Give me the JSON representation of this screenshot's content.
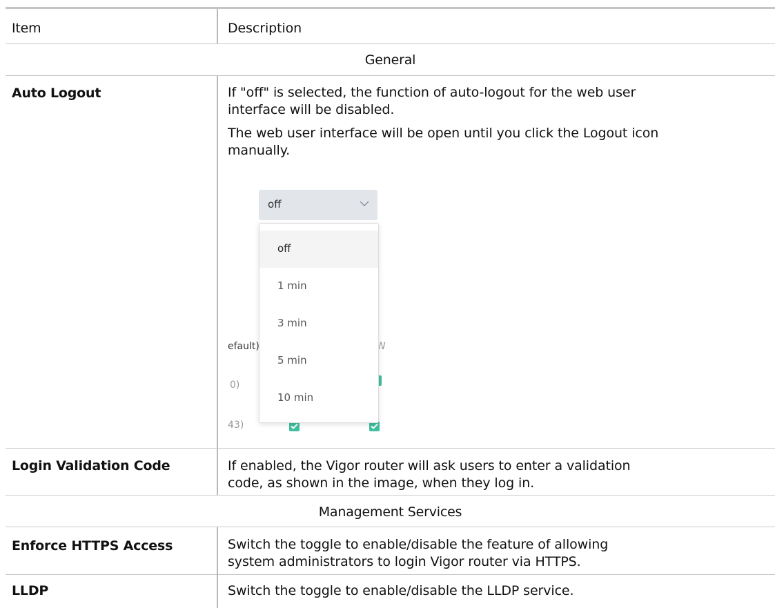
{
  "table": {
    "header": {
      "item": "Item",
      "description": "Description"
    },
    "sections": [
      {
        "title": "General",
        "rows": [
          {
            "item": "Auto Logout",
            "desc": [
              "If \"off\" is selected, the function of auto-logout for the web user",
              "interface will be disabled.",
              "The web user interface will be open until you click the Logout icon",
              "manually."
            ]
          },
          {
            "item": "Login Validation Code",
            "desc": [
              "If enabled, the Vigor router will ask users to enter a validation",
              "code, as shown in the image, when they log in."
            ]
          }
        ]
      },
      {
        "title": "Management Services",
        "rows": [
          {
            "item": "Enforce HTTPS Access",
            "desc": [
              "Switch the toggle to enable/disable the feature of allowing",
              "system administrators to login Vigor router via HTTPS."
            ]
          },
          {
            "item": "LLDP",
            "desc": [
              "Switch the toggle to enable/disable the LLDP service."
            ]
          }
        ]
      }
    ]
  },
  "screenshot": {
    "select_value": "off",
    "options": [
      "off",
      "1 min",
      "3 min",
      "5 min",
      "10 min"
    ],
    "background_fragments": [
      "efault)",
      "W",
      "0)",
      "43)"
    ]
  },
  "colors": {
    "check_green": "#3fbf9f",
    "select_bg": "#e2e5ea",
    "border": "#c8c8c8"
  }
}
